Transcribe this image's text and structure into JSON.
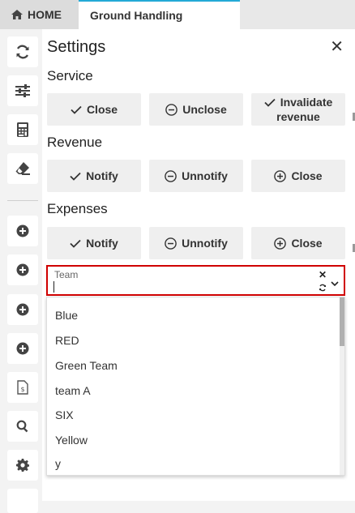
{
  "tabs": {
    "home": "HOME",
    "ground_handling": "Ground Handling"
  },
  "sidebar": {
    "icons": [
      "refresh-icon",
      "sliders-icon",
      "calculator-icon",
      "eraser-icon",
      "plus-circle-icon",
      "plus-circle-icon",
      "plus-circle-icon",
      "plus-circle-icon",
      "invoice-icon",
      "search-icon",
      "gear-icon"
    ]
  },
  "panel": {
    "title": "Settings",
    "close_glyph": "✕",
    "service": {
      "heading": "Service",
      "close": "Close",
      "unclose": "Unclose",
      "invalidate_line1": "Invalidate",
      "invalidate_line2": "revenue"
    },
    "revenue": {
      "heading": "Revenue",
      "notify": "Notify",
      "unnotify": "Unnotify",
      "close": "Close"
    },
    "expenses": {
      "heading": "Expenses",
      "notify": "Notify",
      "unnotify": "Unnotify",
      "close": "Close"
    },
    "team": {
      "label": "Team",
      "value": "",
      "clear_glyph": "✕",
      "options": [
        "Blue",
        "RED",
        "Green Team",
        "team A",
        "SIX",
        "Yellow",
        "y"
      ]
    }
  },
  "colors": {
    "accent": "#23a9d6",
    "focus_border": "#d00000",
    "button_bg": "#efefef"
  }
}
